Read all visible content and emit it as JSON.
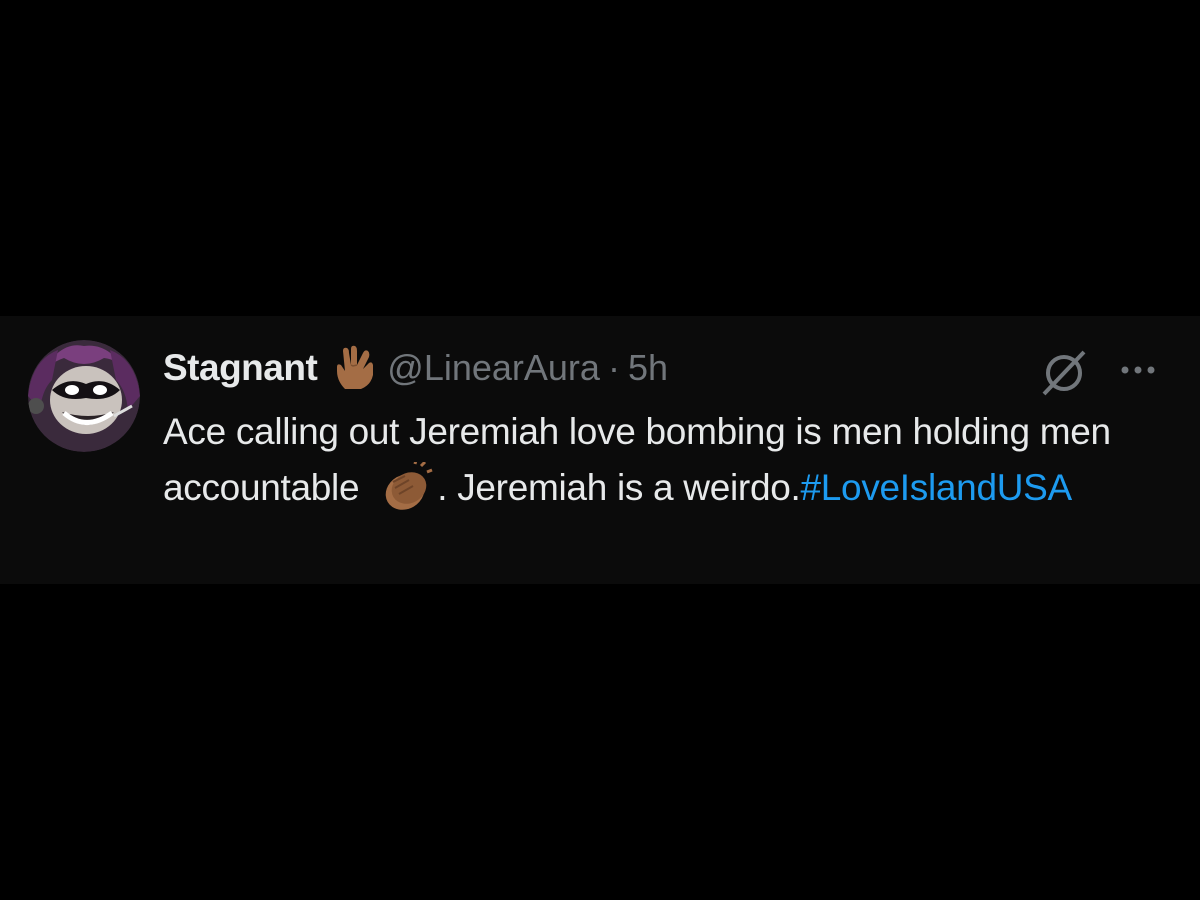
{
  "tweet": {
    "display_name": "Stagnant",
    "name_emoji": "vulcan-salute-emoji",
    "handle": "@LinearAura",
    "separator": "·",
    "time": "5h",
    "text_part1": "Ace calling out Jeremiah love bombing is men holding men accountable",
    "emoji": "clapping-hands-emoji",
    "text_part2": ". Jeremiah is a weirdo.",
    "hashtag": "#LoveIslandUSA"
  },
  "colors": {
    "background": "#000000",
    "card": "#0b0b0b",
    "text": "#e7e9ea",
    "muted": "#71767b",
    "link": "#1d9bf0"
  },
  "icons": [
    "grok-icon",
    "more-icon"
  ]
}
